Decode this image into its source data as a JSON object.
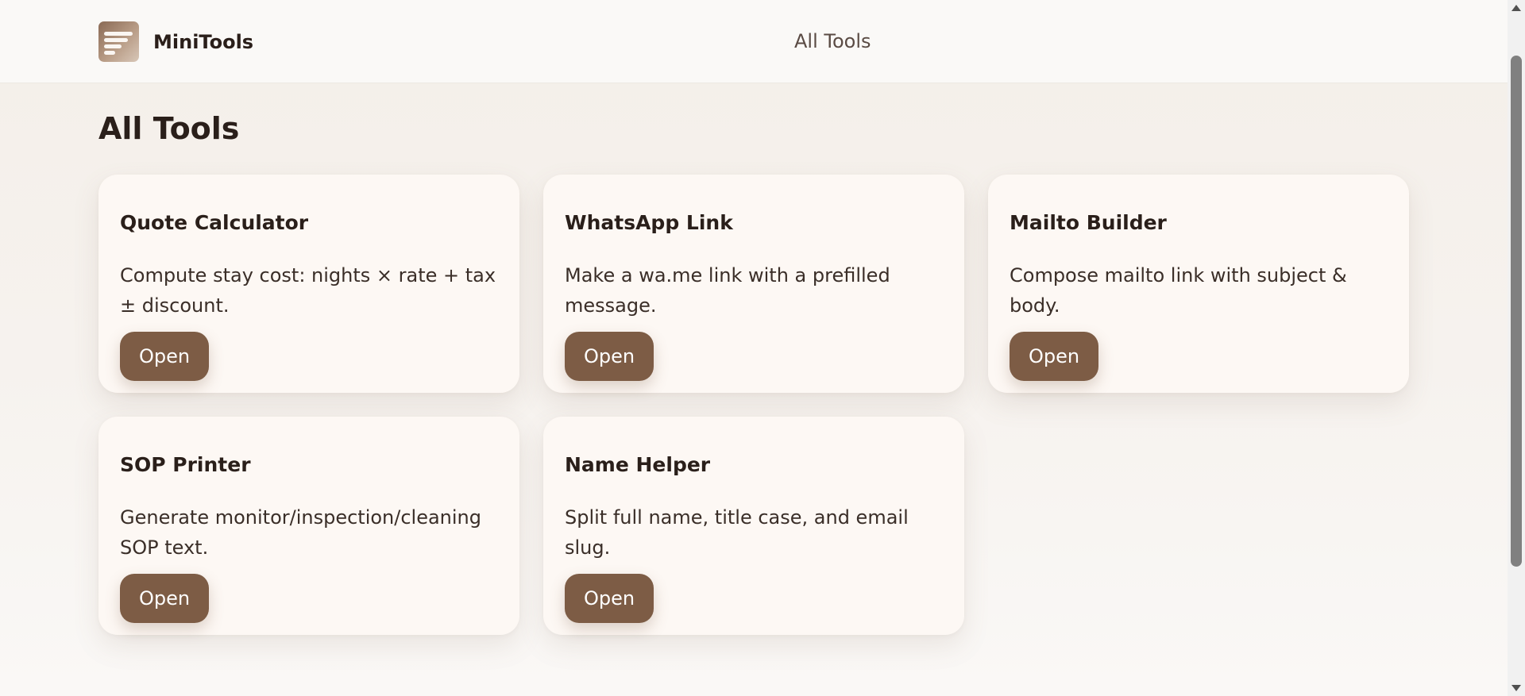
{
  "app": {
    "name": "MiniTools",
    "logo_icon": "lines-icon"
  },
  "nav": {
    "all_tools_link": "All Tools"
  },
  "main": {
    "title": "All Tools",
    "tools": [
      {
        "name": "Quote Calculator",
        "description": "Compute stay cost: nights × rate + tax ± discount.",
        "button": "Open"
      },
      {
        "name": "WhatsApp Link",
        "description": "Make a wa.me link with a prefilled message.",
        "button": "Open"
      },
      {
        "name": "Mailto Builder",
        "description": "Compose mailto link with subject & body.",
        "button": "Open"
      },
      {
        "name": "SOP Printer",
        "description": "Generate monitor/inspection/cleaning SOP text.",
        "button": "Open"
      },
      {
        "name": "Name Helper",
        "description": "Split full name, title case, and email slug.",
        "button": "Open"
      }
    ]
  },
  "colors": {
    "accent": "#7d5c45",
    "background": "#f4efe9",
    "card": "#fdf8f4",
    "text": "#2a1f1a"
  }
}
